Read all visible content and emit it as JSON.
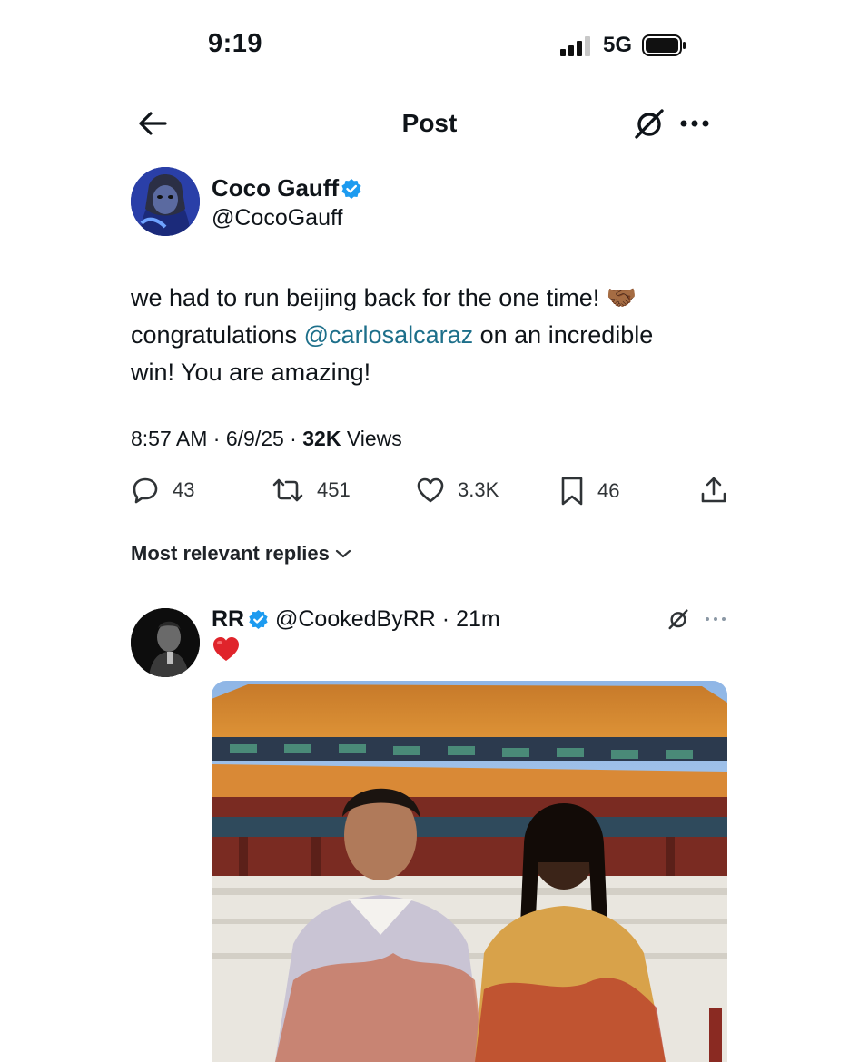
{
  "status_bar": {
    "time": "9:19",
    "network": "5G"
  },
  "header": {
    "title": "Post"
  },
  "tweet": {
    "author_name": "Coco Gauff",
    "author_handle": "@CocoGauff",
    "text_line1": "we had to run beijing back for the one time!",
    "text_congrats": "congratulations",
    "mention": "@carlosalcaraz",
    "text_after_mention": "on an incredible",
    "text_line3": "win! You are amazing!",
    "emoji": "🤝🏾",
    "time": "8:57 AM",
    "date": "6/9/25",
    "views_count": "32K",
    "views_label": "Views",
    "replies": "43",
    "reposts": "451",
    "likes": "3.3K",
    "bookmarks": "46"
  },
  "replies_sort": {
    "label": "Most relevant replies"
  },
  "reply": {
    "name": "RR",
    "handle": "@CookedByRR",
    "age": "21m",
    "text": "❤️"
  },
  "colors": {
    "verified": "#1d9bf0",
    "mention": "#1d6f8a",
    "heart": "#e0242b"
  },
  "icons": [
    "back-arrow-icon",
    "grok-icon",
    "more-icon",
    "verified-badge-icon",
    "reply-icon",
    "repost-icon",
    "like-icon",
    "bookmark-icon",
    "share-icon",
    "chevron-down-icon"
  ]
}
